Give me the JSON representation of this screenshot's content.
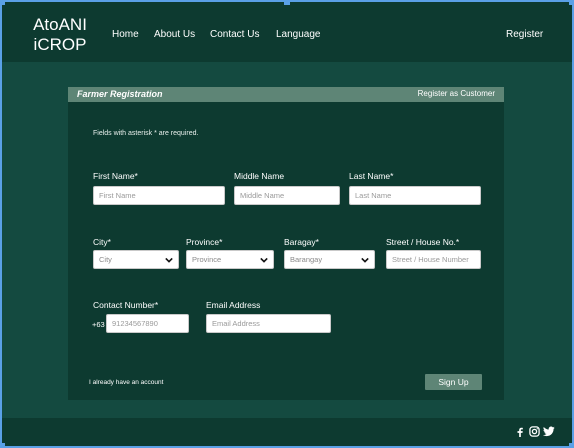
{
  "navbar": {
    "brand_line1": "AtoANI",
    "brand_line2": "iCROP",
    "links": [
      "Home",
      "About Us",
      "Contact Us",
      "Language"
    ],
    "register": "Register"
  },
  "card": {
    "title": "Farmer Registration",
    "register_customer": "Register as Customer",
    "note": "Fields with asterisk * are required.",
    "first_name": {
      "label": "First Name*",
      "placeholder": "First Name"
    },
    "middle_name": {
      "label": "Middle Name",
      "placeholder": "Middle Name"
    },
    "last_name": {
      "label": "Last Name*",
      "placeholder": "Last Name"
    },
    "city": {
      "label": "City*",
      "value": "City"
    },
    "province": {
      "label": "Province*",
      "value": "Province"
    },
    "barangay": {
      "label": "Baragay*",
      "value": "Barangay"
    },
    "street": {
      "label": "Street / House No.*",
      "placeholder": "Street / House Number"
    },
    "contact": {
      "label": "Contact Number*",
      "prefix": "+63",
      "placeholder": "91234567890"
    },
    "email": {
      "label": "Email Address",
      "placeholder": "Email Address"
    },
    "have_account": "I already have an account",
    "signup": "Sign Up"
  },
  "footer": {
    "icons": [
      "facebook-icon",
      "instagram-icon",
      "twitter-icon"
    ]
  },
  "colors": {
    "background": "#144a40",
    "panel": "#0d3a30",
    "accent": "#5e8576"
  }
}
